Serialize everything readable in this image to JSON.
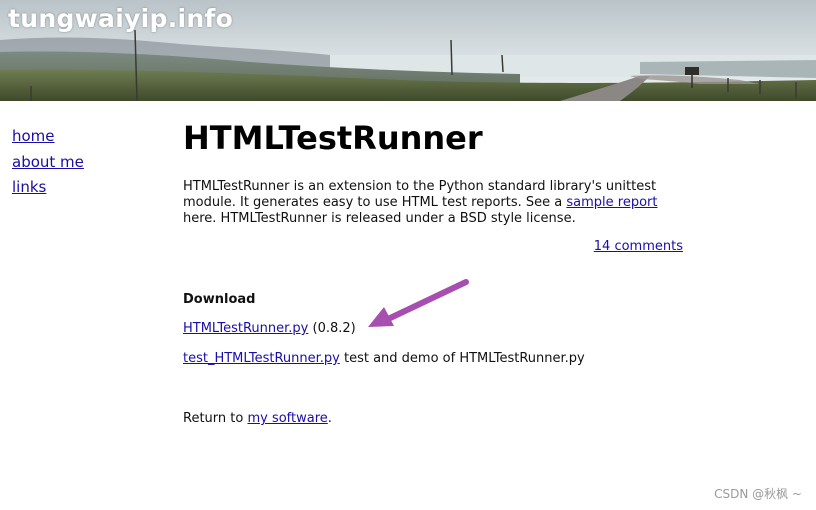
{
  "banner": {
    "site_title": "tungwaiyip.info"
  },
  "nav": [
    {
      "label": "home"
    },
    {
      "label": "about me"
    },
    {
      "label": "links"
    }
  ],
  "main": {
    "title": "HTMLTestRunner",
    "intro_before_link": "HTMLTestRunner is an extension to the Python standard library's unittest module. It generates easy to use HTML test reports. See a ",
    "intro_link": "sample report",
    "intro_after_link": " here. HTMLTestRunner is released under a BSD style license.",
    "comments_link": "14 comments",
    "download_heading": "Download",
    "downloads": [
      {
        "link": "HTMLTestRunner.py",
        "text": " (0.8.2)"
      },
      {
        "link": "test_HTMLTestRunner.py",
        "text": " test and demo of HTMLTestRunner.py"
      }
    ],
    "return_prefix": "Return to ",
    "return_link": "my software",
    "return_suffix": "."
  },
  "annotation": {
    "arrow_color": "#a64fb0"
  },
  "watermark": "CSDN @秋枫 ~"
}
